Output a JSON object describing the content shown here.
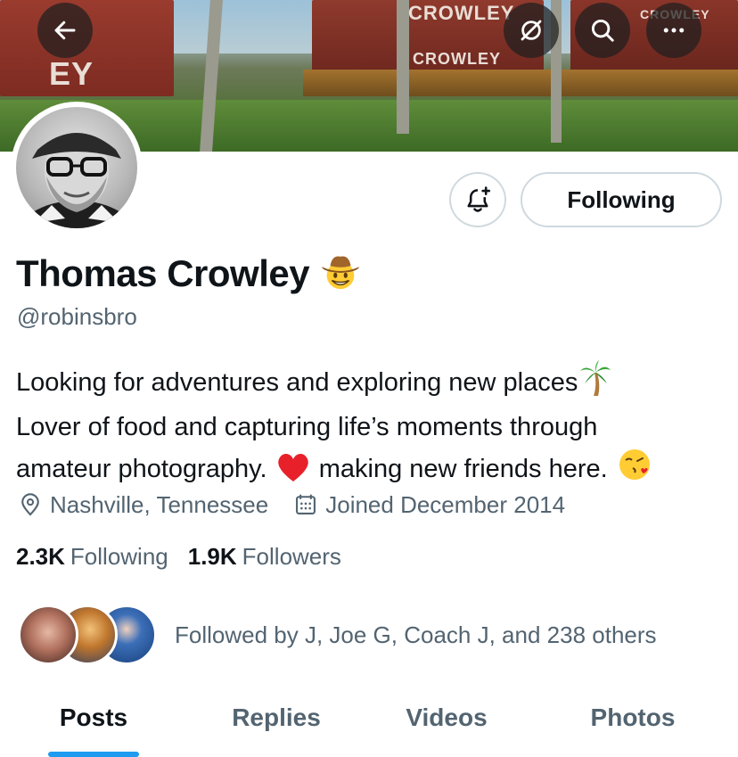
{
  "header": {
    "back_icon": "arrow-left-icon",
    "actions": [
      {
        "icon": "grok-icon"
      },
      {
        "icon": "search-icon"
      },
      {
        "icon": "more-icon"
      }
    ]
  },
  "profile": {
    "display_name": "Thomas Crowley",
    "name_emoji": "cowboy-hat-face",
    "handle": "@robinsbro",
    "bio_lines": [
      {
        "text": "Looking for adventures and exploring new places",
        "emoji": "palm-tree"
      },
      {
        "text": "Lover of food and capturing life’s moments through"
      },
      {
        "text_before": "amateur photography.",
        "emoji_mid": "red-heart",
        "text_after": "making new friends here.",
        "emoji_end": "face-blowing-kiss"
      }
    ],
    "location": "Nashville, Tennessee",
    "joined": "Joined December 2014",
    "following_count": "2.3K",
    "following_label": "Following",
    "followers_count": "1.9K",
    "followers_label": "Followers",
    "followed_by": "Followed by J, Joe G, Coach J, and 238 others"
  },
  "buttons": {
    "notify_icon": "bell-plus-icon",
    "following_label": "Following"
  },
  "banner": {
    "words": [
      "CROWLEY",
      "CROWLEY",
      "EY",
      "CROWLEY"
    ]
  },
  "tabs": [
    {
      "label": "Posts",
      "active": true
    },
    {
      "label": "Replies",
      "active": false
    },
    {
      "label": "Videos",
      "active": false
    },
    {
      "label": "Photos",
      "active": false
    }
  ],
  "colors": {
    "accent": "#1d9bf0",
    "text_primary": "#0f1419",
    "text_secondary": "#536471",
    "border": "#cfd9de"
  }
}
